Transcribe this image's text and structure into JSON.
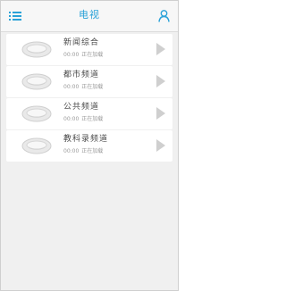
{
  "header": {
    "title": "电视",
    "menu_icon": "list-menu-icon",
    "user_icon": "user-icon",
    "accent_color": "#2aa2d8"
  },
  "channels": [
    {
      "name": "新闻综合",
      "time": "00:00",
      "status": "正在加载"
    },
    {
      "name": "都市频道",
      "time": "00:00",
      "status": "正在加载"
    },
    {
      "name": "公共频道",
      "time": "00:00",
      "status": "正在加载"
    },
    {
      "name": "教科录频道",
      "time": "00:00",
      "status": "正在加载"
    }
  ]
}
